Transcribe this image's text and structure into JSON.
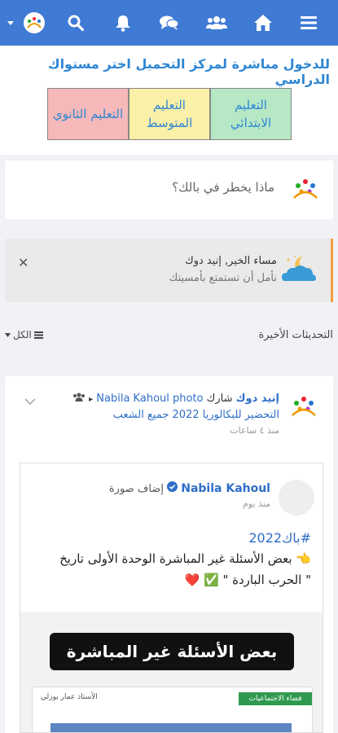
{
  "topbar": {
    "icons": [
      "menu-icon",
      "home-icon",
      "group-icon",
      "chat-icon",
      "bell-icon",
      "search-icon",
      "logo-avatar"
    ],
    "color": "#3f7ad4"
  },
  "promo": {
    "title": "للدخول مباشرة لمركز التحميل اختر مستواك الدراسي",
    "levels": [
      {
        "label": "التعليم الابتدائي",
        "color": "#b7e8c6"
      },
      {
        "label": "التعليم المتوسط",
        "color": "#fbf0a7"
      },
      {
        "label": "التعليم الثانوي",
        "color": "#f6b9ba"
      }
    ]
  },
  "composer": {
    "placeholder": "ماذا يخطر في بالك؟"
  },
  "greeting": {
    "title": "مساء الخير, إنيد دوك",
    "subtitle": "نأمل أن تستمتع بأمسيتك"
  },
  "feed": {
    "updates_label": "التحديثات الأخيرة",
    "filter_label": "الكل"
  },
  "post": {
    "author": "إنيد دوك",
    "action": "شارك",
    "shared_target": "Nabila Kahoul photo",
    "group_name": "التحضير للبكالوريا 2022 جميع الشعب",
    "time": "منذ ٤ ساعات",
    "shared": {
      "author": "Nabila Kahoul",
      "action": "إضاف صورة",
      "time": "منذ يوم",
      "hashtag": "#باك2022",
      "line1": "👈 بعض الأسئلة غير المباشرة الوحدة الأولى تاريخ",
      "line2": "\" الحرب الباردة \" ✅ ❤️",
      "banner_text": "بعض الأسئلة غير المباشرة",
      "sheet_green": "فضاء الاجتماعيات",
      "sheet_text": "الأستاذ عمار يوزلي"
    }
  }
}
